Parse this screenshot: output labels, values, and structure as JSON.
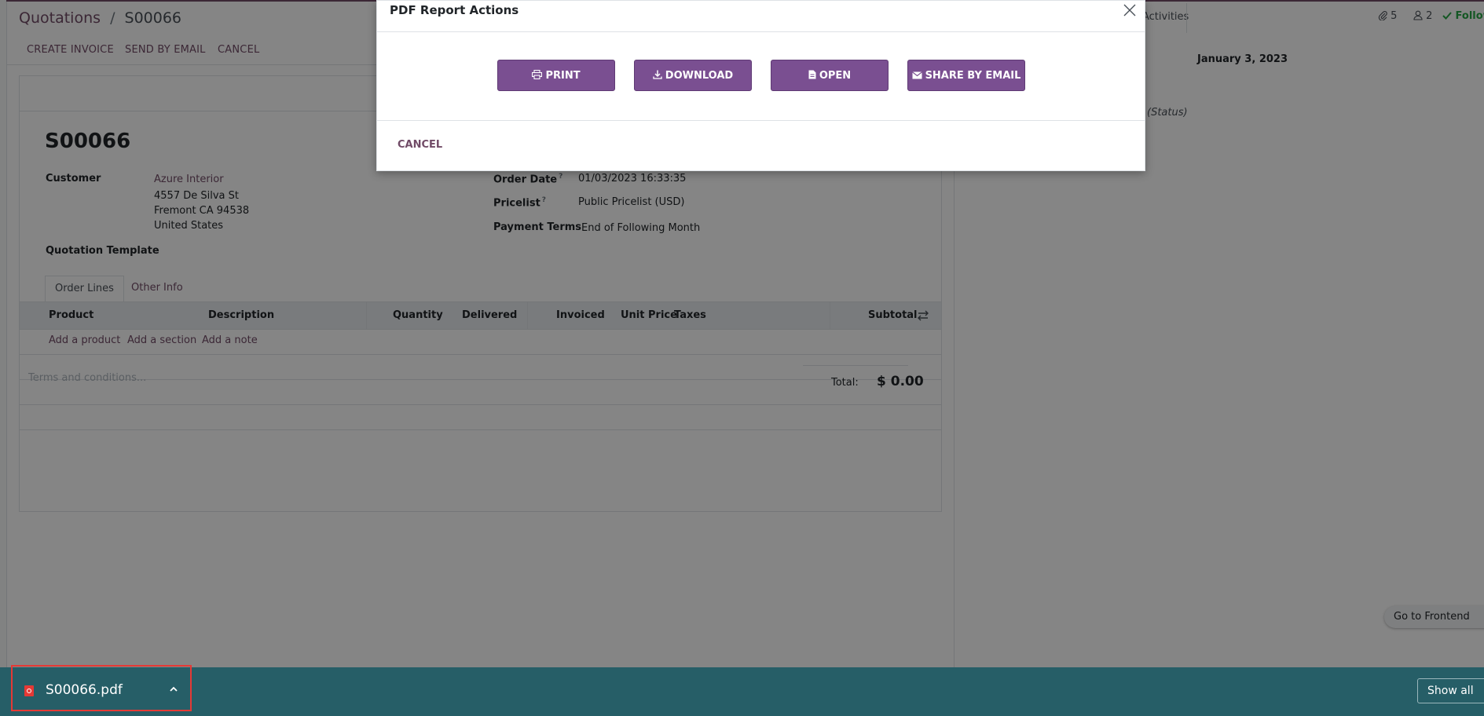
{
  "breadcrumb": {
    "parent": "Quotations",
    "separator": "/",
    "current": "S00066"
  },
  "control_bar": {
    "create_invoice": "CREATE INVOICE",
    "send_by_email": "SEND BY EMAIL",
    "cancel": "CANCEL"
  },
  "chatter": {
    "activities": "Activities",
    "attachments_count": "5",
    "followers_count": "2",
    "follow": "Follow",
    "date_separator": "January 3, 2023",
    "status_text": "(Status)"
  },
  "form": {
    "name": "S00066",
    "customer_label": "Customer",
    "customer_name": "Azure Interior",
    "address_line1": "4557 De Silva St",
    "address_line2": "Fremont CA 94538",
    "address_line3": "United States",
    "quotation_template_label": "Quotation Template",
    "order_date_label": "Order Date",
    "order_date_value": "01/03/2023 16:33:35",
    "pricelist_label": "Pricelist",
    "pricelist_value": "Public Pricelist (USD)",
    "payment_terms_label": "Payment Terms",
    "payment_terms_value": "End of Following Month",
    "help_mark": "?"
  },
  "tabs": {
    "order_lines": "Order Lines",
    "other_info": "Other Info"
  },
  "table": {
    "columns": [
      "Product",
      "Description",
      "Quantity",
      "Delivered",
      "Invoiced",
      "Unit Price",
      "Taxes",
      "Subtotal"
    ],
    "add_product": "Add a product",
    "add_section": "Add a section",
    "add_note": "Add a note"
  },
  "footer": {
    "terms_placeholder": "Terms and conditions...",
    "total_label": "Total:",
    "total_value": "$ 0.00"
  },
  "go_to_frontend": "Go to Frontend",
  "modal": {
    "title": "PDF Report Actions",
    "print": "PRINT",
    "download": "DOWNLOAD",
    "open": "OPEN",
    "share_by_email": "SHARE BY EMAIL",
    "cancel": "CANCEL"
  },
  "download_bar": {
    "file_name": "S00066.pdf",
    "show_all": "Show all"
  },
  "colors": {
    "brand": "#714B67",
    "button": "#7a4f91",
    "download_bar": "#265e67",
    "highlight": "#e53935"
  }
}
